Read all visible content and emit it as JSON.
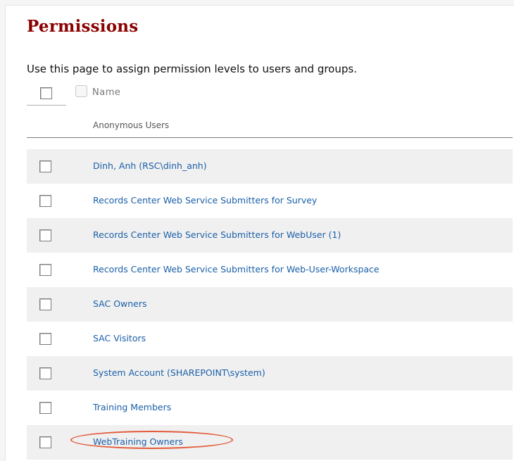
{
  "page": {
    "title": "Permissions",
    "description": "Use this page to assign permission levels to users and groups."
  },
  "table": {
    "header_name": "Name",
    "anonymous_label": "Anonymous Users",
    "rows": [
      {
        "name": "Dinh, Anh (RSC\\dinh_anh)",
        "shaded": true
      },
      {
        "name": "Records Center Web Service Submitters for Survey",
        "shaded": false
      },
      {
        "name": "Records Center Web Service Submitters for WebUser (1)",
        "shaded": true
      },
      {
        "name": "Records Center Web Service Submitters for Web-User-Workspace",
        "shaded": false
      },
      {
        "name": "SAC Owners",
        "shaded": true
      },
      {
        "name": "SAC Visitors",
        "shaded": false
      },
      {
        "name": "System Account (SHAREPOINT\\system)",
        "shaded": true
      },
      {
        "name": "Training Members",
        "shaded": false
      },
      {
        "name": "WebTraining Owners",
        "shaded": true,
        "highlighted": true
      }
    ]
  },
  "colors": {
    "title": "#8b0000",
    "link": "#1a5fa8",
    "row_shade": "#f0f0f0",
    "highlight": "#e25a3b"
  }
}
